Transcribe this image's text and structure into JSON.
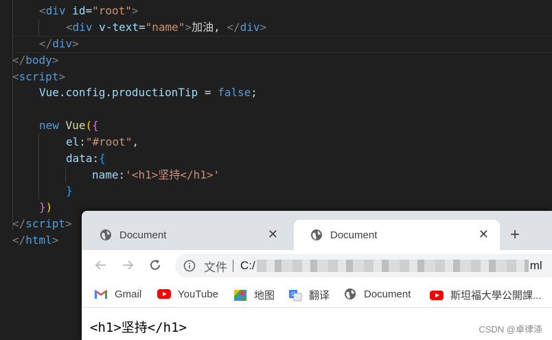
{
  "editor": {
    "lines": [
      {
        "tokens": [
          {
            "t": "<",
            "c": "punct"
          },
          {
            "t": "div",
            "c": "tag"
          },
          {
            "t": " id",
            "c": "attr"
          },
          {
            "t": "=",
            "c": "plain"
          },
          {
            "t": "\"root\"",
            "c": "str"
          },
          {
            "t": ">",
            "c": "punct"
          }
        ]
      },
      {
        "tokens": [
          {
            "t": "<",
            "c": "punct"
          },
          {
            "t": "div",
            "c": "tag"
          },
          {
            "t": " v-text",
            "c": "attr"
          },
          {
            "t": "=",
            "c": "plain"
          },
          {
            "t": "\"name\"",
            "c": "str"
          },
          {
            "t": ">",
            "c": "punct"
          },
          {
            "t": "加油, ",
            "c": "plain"
          },
          {
            "t": "</",
            "c": "punct"
          },
          {
            "t": "div",
            "c": "tag"
          },
          {
            "t": ">",
            "c": "punct"
          }
        ]
      },
      {
        "tokens": [
          {
            "t": "</",
            "c": "punct"
          },
          {
            "t": "div",
            "c": "tag"
          },
          {
            "t": ">",
            "c": "punct"
          }
        ]
      },
      {
        "tokens": [
          {
            "t": "</",
            "c": "punct"
          },
          {
            "t": "body",
            "c": "tag"
          },
          {
            "t": ">",
            "c": "punct"
          }
        ]
      },
      {
        "tokens": [
          {
            "t": "<",
            "c": "punct"
          },
          {
            "t": "script",
            "c": "tag"
          },
          {
            "t": ">",
            "c": "punct"
          }
        ]
      },
      {
        "tokens": [
          {
            "t": "Vue",
            "c": "prop"
          },
          {
            "t": ".",
            "c": "plain"
          },
          {
            "t": "config",
            "c": "prop"
          },
          {
            "t": ".",
            "c": "plain"
          },
          {
            "t": "productionTip",
            "c": "prop"
          },
          {
            "t": " = ",
            "c": "plain"
          },
          {
            "t": "false",
            "c": "kw"
          },
          {
            "t": ";",
            "c": "plain"
          }
        ]
      },
      {
        "tokens": []
      },
      {
        "tokens": [
          {
            "t": "new",
            "c": "kw"
          },
          {
            "t": " ",
            "c": "plain"
          },
          {
            "t": "Vue",
            "c": "text-yellow"
          },
          {
            "t": "(",
            "c": "brace1"
          },
          {
            "t": "{",
            "c": "brace2"
          }
        ]
      },
      {
        "tokens": [
          {
            "t": "el",
            "c": "prop"
          },
          {
            "t": ":",
            "c": "plain"
          },
          {
            "t": "\"#root\"",
            "c": "str"
          },
          {
            "t": ",",
            "c": "plain"
          }
        ]
      },
      {
        "tokens": [
          {
            "t": "data",
            "c": "prop"
          },
          {
            "t": ":",
            "c": "plain"
          },
          {
            "t": "{",
            "c": "brace3"
          }
        ]
      },
      {
        "tokens": [
          {
            "t": "name",
            "c": "prop"
          },
          {
            "t": ":",
            "c": "plain"
          },
          {
            "t": "'<h1>坚持</h1>'",
            "c": "str"
          }
        ]
      },
      {
        "tokens": [
          {
            "t": "}",
            "c": "brace3"
          }
        ]
      },
      {
        "tokens": [
          {
            "t": "}",
            "c": "brace2"
          },
          {
            "t": ")",
            "c": "brace1"
          }
        ]
      },
      {
        "tokens": [
          {
            "t": "</",
            "c": "punct"
          },
          {
            "t": "script",
            "c": "tag"
          },
          {
            "t": ">",
            "c": "punct"
          }
        ]
      },
      {
        "tokens": [
          {
            "t": "</",
            "c": "punct"
          },
          {
            "t": "html",
            "c": "tag"
          },
          {
            "t": ">",
            "c": "punct"
          }
        ]
      }
    ]
  },
  "browser": {
    "tabs": [
      {
        "title": "Document",
        "close": "✕"
      },
      {
        "title": "Document",
        "close": "✕"
      }
    ],
    "new_tab": "+",
    "omnibox": {
      "label": "文件",
      "url_start": "C:/",
      "url_end": "ml"
    },
    "bookmarks": [
      {
        "label": "Gmail",
        "icon": "gmail-icon"
      },
      {
        "label": "YouTube",
        "icon": "youtube-icon"
      },
      {
        "label": "地图",
        "icon": "maps-icon"
      },
      {
        "label": "翻译",
        "icon": "translate-icon"
      },
      {
        "label": "Document",
        "icon": "globe-icon"
      },
      {
        "label": "斯坦福大學公開課...",
        "icon": "youtube-icon"
      }
    ],
    "page_content": "<h1>坚持</h1>"
  },
  "watermark": "CSDN @卓律涤",
  "colors": {
    "editor_bg": "#1f1f1f",
    "tag": "#569cd6",
    "attr": "#9cdcfe",
    "string": "#ce9178",
    "tabstrip_bg": "#dee1e6"
  }
}
